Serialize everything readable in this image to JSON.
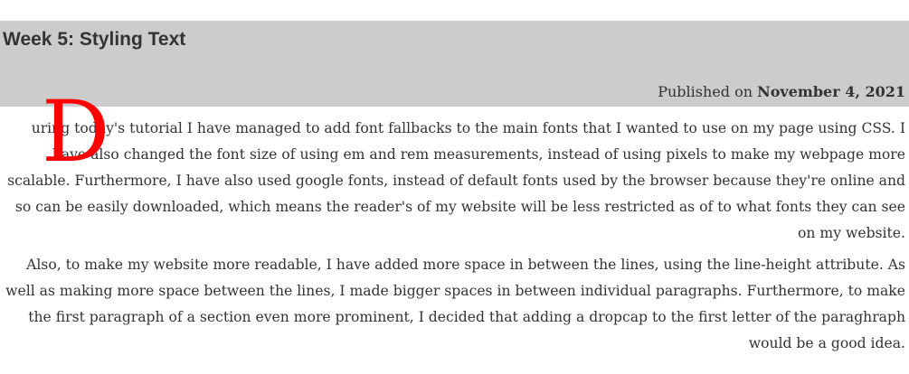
{
  "header": {
    "title": "Week 5: Styling Text",
    "published_prefix": "Published on ",
    "published_date": "November 4, 2021"
  },
  "article": {
    "dropcap": "D",
    "paragraph1": "uring today's tutorial I have managed to add font fallbacks to the main fonts that I wanted to use on my page using CSS. I have also changed the font size of using em and rem measurements, instead of using pixels to make my webpage more scalable. Furthermore, I have also used google fonts, instead of default fonts used by the browser because they're online and so can be easily downloaded, which means the reader's of my website will be less restricted as of to what fonts they can see on my website.",
    "paragraph2": "Also, to make my website more readable, I have added more space in between the lines, using the line-height attribute. As well as making more space between the lines, I made bigger spaces in between individual paragraphs. Furthermore, to make the first paragraph of a section even more prominent, I decided that adding a dropcap to the first letter of the paraghraph would be a good idea."
  },
  "colors": {
    "header_background": "#cccccc",
    "dropcap": "#ff0000",
    "text": "#333333"
  }
}
